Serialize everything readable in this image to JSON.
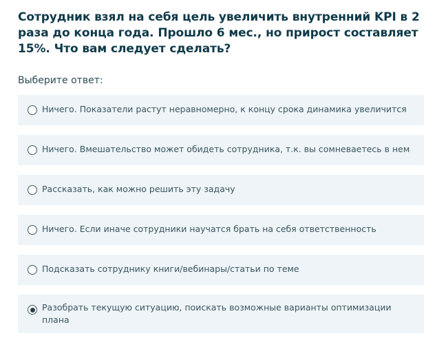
{
  "question": {
    "text": "Сотрудник взял на себя цель увеличить внутренний KPI в 2 раза до конца года. Прошло 6 мес., но прирост составляет 15%. Что вам следует сделать?"
  },
  "prompt": "Выберите ответ:",
  "options": [
    {
      "label": "Ничего. Показатели растут неравномерно, к концу срока динамика увеличится",
      "selected": false
    },
    {
      "label": "Ничего. Вмешательство может обидеть сотрудника, т.к. вы сомневаетесь в нем",
      "selected": false
    },
    {
      "label": "Рассказать, как можно решить эту задачу",
      "selected": false
    },
    {
      "label": "Ничего. Если иначе сотрудники научатся брать на себя ответственность",
      "selected": false
    },
    {
      "label": "Подсказать сотруднику книги/вебинары/статьи по теме",
      "selected": false
    },
    {
      "label": "Разобрать текущую ситуацию, поискать возможные варианты оптимизации плана",
      "selected": true
    }
  ]
}
